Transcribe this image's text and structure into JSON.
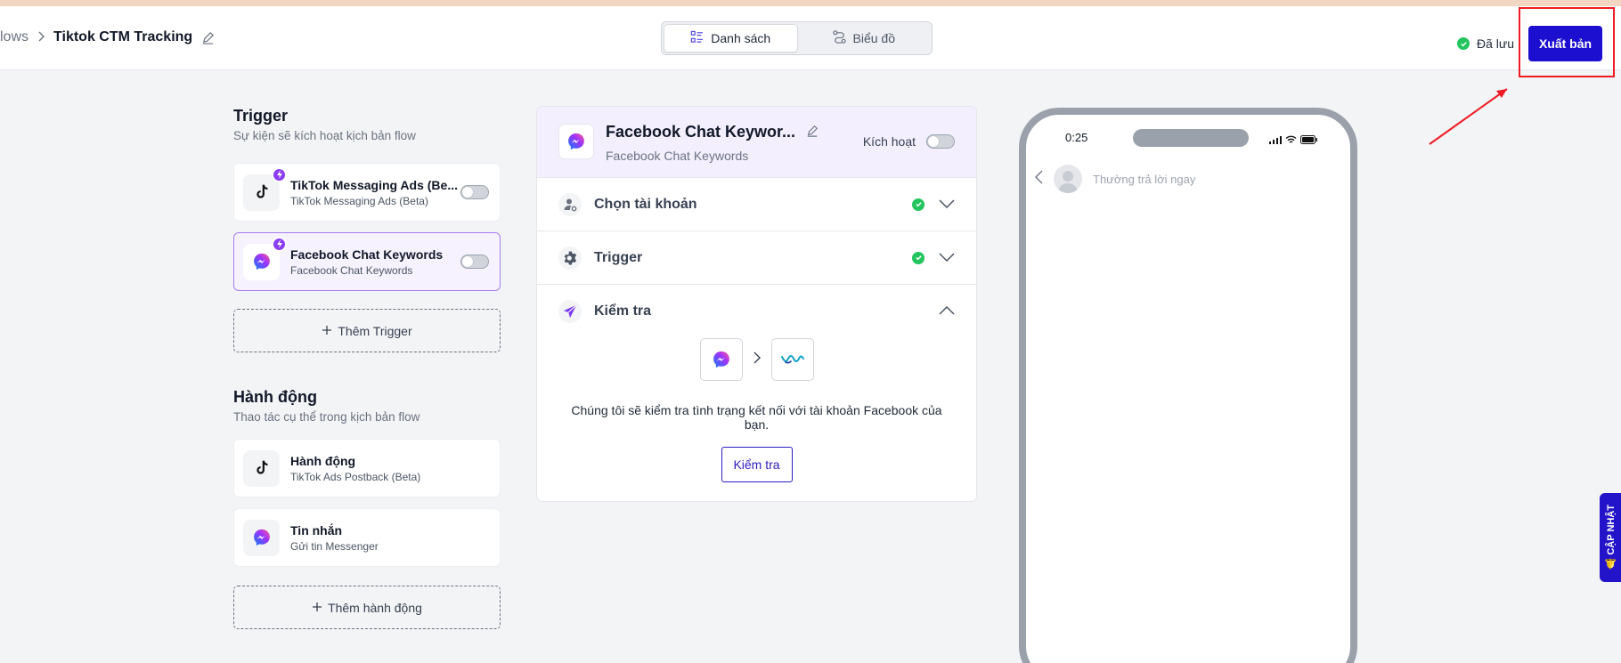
{
  "header": {
    "breadcrumb_prev": "lows",
    "breadcrumb_current": "Tiktok CTM Tracking",
    "view_tabs": [
      {
        "label": "Danh sách",
        "icon": "list-icon",
        "active": true
      },
      {
        "label": "Biểu đồ",
        "icon": "flow-icon",
        "active": false
      }
    ],
    "saved_label": "Đã lưu",
    "publish_label": "Xuất bản"
  },
  "trigger_section": {
    "title": "Trigger",
    "subtitle": "Sự kiện sẽ kích hoạt kịch bản flow",
    "items": [
      {
        "title": "TikTok Messaging Ads (Be...",
        "subtitle": "TikTok Messaging Ads (Beta)",
        "icon": "tiktok-icon",
        "selected": false
      },
      {
        "title": "Facebook Chat Keywords",
        "subtitle": "Facebook Chat Keywords",
        "icon": "messenger-icon",
        "selected": true
      }
    ],
    "add_label": "Thêm Trigger"
  },
  "action_section": {
    "title": "Hành động",
    "subtitle": "Thao tác cụ thể trong kịch bản flow",
    "items": [
      {
        "title": "Hành động",
        "subtitle": "TikTok Ads Postback (Beta)",
        "icon": "tiktok-icon"
      },
      {
        "title": "Tin nhắn",
        "subtitle": "Gửi tin Messenger",
        "icon": "messenger-icon"
      }
    ],
    "add_label": "Thêm hành động"
  },
  "detail_panel": {
    "title": "Facebook Chat Keywor...",
    "subtitle": "Facebook Chat Keywords",
    "activate_label": "Kích hoạt",
    "rows": [
      {
        "label": "Chọn tài khoản",
        "icon": "user-gear-icon",
        "done": true,
        "expanded": false
      },
      {
        "label": "Trigger",
        "icon": "gear-icon",
        "done": true,
        "expanded": false
      },
      {
        "label": "Kiểm tra",
        "icon": "send-icon",
        "done": false,
        "expanded": true
      }
    ],
    "check_text": "Chúng tôi sẽ kiểm tra tình trạng kết nối với tài khoản Facebook của bạn.",
    "check_button": "Kiểm tra"
  },
  "phone_preview": {
    "time": "0:25",
    "reply_text": "Thường trả lời ngay"
  },
  "update_tab": "🔔 CẬP NHẬT",
  "colors": {
    "primary": "#1d0fcf",
    "selected_border": "#a77cf5",
    "success": "#22c55e",
    "highlight_red": "#ef1b24"
  }
}
